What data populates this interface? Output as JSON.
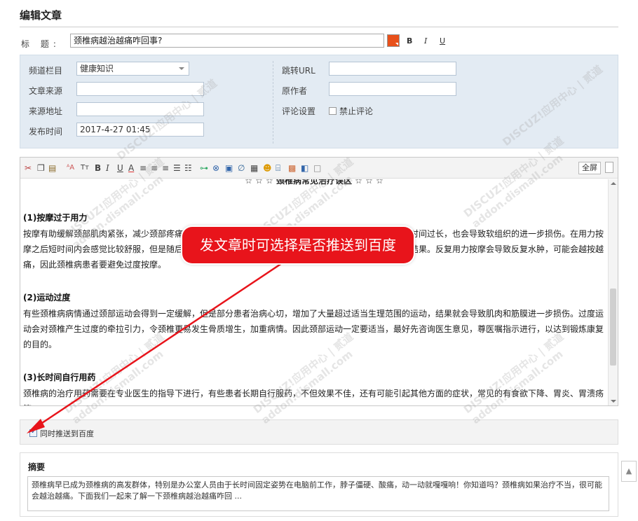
{
  "page": {
    "title": "编辑文章"
  },
  "title_field": {
    "label": "标 题:",
    "value": "颈椎病越治越痛咋回事?",
    "format_bold": "B",
    "format_italic": "I",
    "format_underline": "U",
    "color": "#e8501a"
  },
  "meta": {
    "channel_label": "频道栏目",
    "channel_value": "健康知识",
    "jump_url_label": "跳转URL",
    "jump_url_value": "",
    "source_label": "文章来源",
    "source_value": "",
    "original_author_label": "原作者",
    "original_author_value": "",
    "source_url_label": "来源地址",
    "source_url_value": "",
    "comment_setting_label": "评论设置",
    "disable_comment_label": "禁止评论",
    "disable_comment_checked": false,
    "publish_time_label": "发布时间",
    "publish_time_value": "2017-4-27 01:45"
  },
  "editor": {
    "toolbar_icons": [
      "cut-icon",
      "copy-icon",
      "paste-icon",
      "font-family-icon",
      "font-size-icon",
      "bold-icon",
      "italic-icon",
      "underline-icon",
      "font-color-icon",
      "align-left-icon",
      "align-center-icon",
      "align-right-icon",
      "ordered-list-icon",
      "unordered-list-icon",
      "link-icon",
      "unlink-icon",
      "image-icon",
      "attach-icon",
      "table-icon",
      "emoticon-icon",
      "code-icon",
      "media-icon",
      "flash-icon",
      "page-break-icon"
    ],
    "fullscreen_label": "全屏",
    "top_line": "☆ ☆ ☆ 颈椎病常见治疗误区 ☆ ☆ ☆",
    "sections": [
      {
        "heading": "(1)按摩过于用力",
        "text": "按摩有助缓解颈部肌肉紧张，减少颈部疼痛，但并是靠按摩时间越长越好，因为如果按摩力量过大，按摩时间过长，也会导致软组织的进一步损伤。在用力按摩之后短时间内会感觉比较舒服，但是随后可能会出现疼痛加剧，这是由于软组织损伤后出现炎性水肿的结果。反复用力按摩会导致反复水肿，可能会越按越痛，因此颈椎病患者要避免过度按摩。"
      },
      {
        "heading": "(2)运动过度",
        "text": "有些颈椎病病情通过颈部运动会得到一定缓解，但是部分患者治病心切，增加了大量超过适当生理范围的运动，结果就会导致肌肉和筋膜进一步损伤。过度运动会对颈椎产生过度的牵拉引力，令颈椎更易发生骨质增生，加重病情。因此颈部运动一定要适当，最好先咨询医生意见，尊医嘱指示进行，以达到锻炼康复的目的。"
      },
      {
        "heading": "(3)长时间自行用药",
        "text": "颈椎病的治疗用药需要在专业医生的指导下进行，有些患者长期自行服药，不但效果不佳，还有可能引起其他方面的症状，常见的有食欲下降、胃炎、胃溃疡等。"
      }
    ]
  },
  "push": {
    "label": "同时推送到百度",
    "checked": true
  },
  "summary": {
    "title": "摘要",
    "text": "颈椎病早已成为颈椎病的高发群体，特别是办公室人员由于长时间固定姿势在电脑前工作，脖子僵硬、酸痛，动一动就嘎嘎响！你知道吗？颈椎病如果治疗不当，很可能会越治越痛。下面我们一起来了解一下颈椎病越治越痛咋回 ..."
  },
  "annotation": {
    "callout_text": "发文章时可选择是否推送到百度",
    "color": "#e8141b"
  },
  "watermark": {
    "brand": "DISCUZ!应用中心 | 贰道",
    "domain": "addon.dismall.com"
  },
  "back_to_top": "▲"
}
